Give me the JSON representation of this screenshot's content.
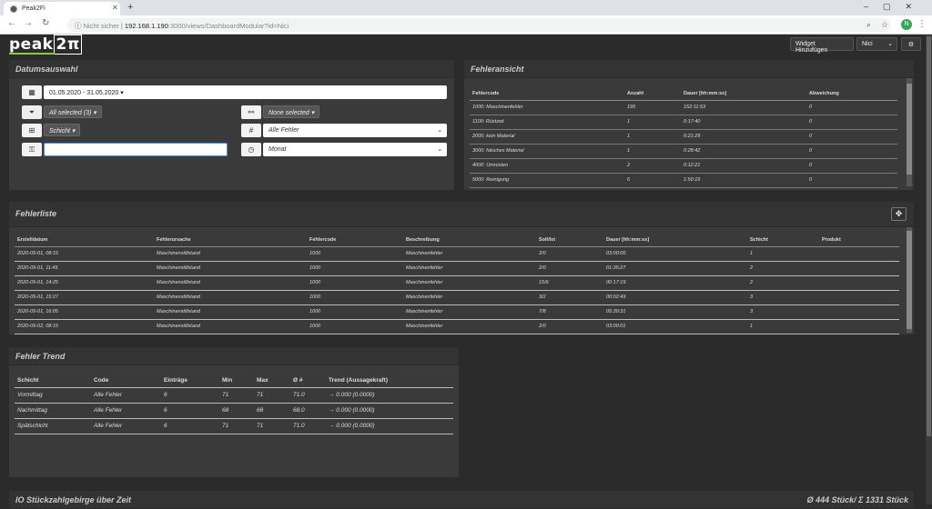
{
  "browser": {
    "tab_title": "Peak2Fi",
    "security": "Nicht sicher",
    "url_host": "192.168.1.190",
    "url_rest": ":3000/views/DashboardModular?id=Nici",
    "avatar_letter": "N"
  },
  "app": {
    "logo": "peak",
    "logo_mark": "2π",
    "widget_add": "Widget Hinzufügen",
    "user_select": "Nici"
  },
  "datumsauswahl": {
    "title": "Datumsauswahl",
    "date_range": "01.05.2020 - 31.05.2020",
    "filter_all": "All selected (3)",
    "filter_none": "None selected",
    "schicht": "Schicht",
    "alle_fehler": "Alle Fehler",
    "monat": "Monat",
    "search_value": ""
  },
  "fehleransicht": {
    "title": "Fehleransicht",
    "headers": [
      "Fehlercode",
      "Anzahl",
      "Dauer [hh:mm:ss]",
      "Abweichung"
    ],
    "rows": [
      [
        "1000: Maschinenfehler",
        "195",
        "152:11:53",
        "0"
      ],
      [
        "1100: Rüstzeit",
        "1",
        "0:17:40",
        "0"
      ],
      [
        "2000: kein Material",
        "1",
        "0:21:29",
        "0"
      ],
      [
        "3000: falsches Material",
        "1",
        "0:28:42",
        "0"
      ],
      [
        "4000: Umrüsten",
        "2",
        "0:12:21",
        "0"
      ],
      [
        "5000: Reinigung",
        "6",
        "1:50:15",
        "0"
      ]
    ]
  },
  "fehlerliste": {
    "title": "Fehlerliste",
    "headers": [
      "Erstelldatum",
      "Fehlerursache",
      "Fehlercode",
      "Beschreibung",
      "Soll/Ist",
      "Dauer [hh:mm:ss]",
      "Schicht",
      "Produkt"
    ],
    "rows": [
      [
        "2020-05-01, 08:15",
        "Maschinenstillstand",
        "1000",
        "Maschinenfehler",
        "2/0",
        "03:00:00",
        "1",
        ""
      ],
      [
        "2020-05-01, 11:45",
        "Maschinenstillstand",
        "1000",
        "Maschinenfehler",
        "2/0",
        "01:35:27",
        "2",
        ""
      ],
      [
        "2020-05-01, 14:25",
        "Maschinenstillstand",
        "1000",
        "Maschinenfehler",
        "15/6",
        "00:17:19",
        "2",
        ""
      ],
      [
        "2020-05-01, 15:27",
        "Maschinenstillstand",
        "1000",
        "Maschinenfehler",
        "3/2",
        "00:02:49",
        "3",
        ""
      ],
      [
        "2020-05-01, 16:05",
        "Maschinenstillstand",
        "1000",
        "Maschinenfehler",
        "7/8",
        "05:39:31",
        "3",
        ""
      ],
      [
        "2020-05-02, 08:15",
        "Maschinenstillstand",
        "1000",
        "Maschinenfehler",
        "2/0",
        "03:00:01",
        "1",
        ""
      ]
    ]
  },
  "fehlertrend": {
    "title": "Fehler Trend",
    "headers": [
      "Schicht",
      "Code",
      "Einträge",
      "Min",
      "Max",
      "Ø #",
      "Trend (Aussagekraft)"
    ],
    "rows": [
      [
        "Vormittag",
        "Alle Fehler",
        "6",
        "71",
        "71",
        "71.0",
        "→ 0.000 (0.0000)"
      ],
      [
        "Nachmittag",
        "Alle Fehler",
        "6",
        "68",
        "68",
        "68.0",
        "→ 0.000 (0.0000)"
      ],
      [
        "Spätschicht",
        "Alle Fehler",
        "6",
        "71",
        "71",
        "71.0",
        "→ 0.000 (0.0000)"
      ]
    ]
  },
  "stueckzahl": {
    "title": "IO Stückzahlgebirge über Zeit",
    "summary": "Ø 444 Stück/ Σ 1331 Stück"
  },
  "colors": {
    "accent": "#8dc63f",
    "panel": "#3a3a3a",
    "background": "#2b2b2b"
  }
}
